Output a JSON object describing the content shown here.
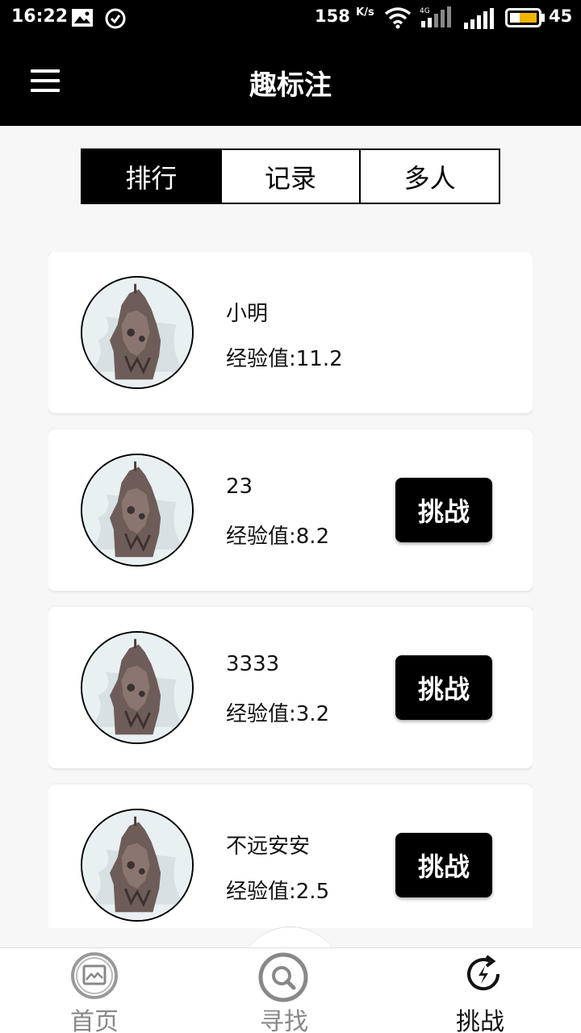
{
  "status_bar": {
    "time": "16:22",
    "network_speed": "158",
    "speed_unit": "K/s",
    "signal_type": "4G",
    "battery": "45",
    "icons": [
      "image-icon",
      "check-circle-icon",
      "wifi-icon",
      "cell-signal-icon",
      "battery-icon"
    ]
  },
  "app_bar": {
    "title": "趣标注",
    "menu_icon": "hamburger-menu-icon"
  },
  "tabs": [
    {
      "label": "排行",
      "active": true
    },
    {
      "label": "记录",
      "active": false
    },
    {
      "label": "多人",
      "active": false
    }
  ],
  "leaderboard": [
    {
      "name": "小明",
      "exp": "经验值:11.2",
      "has_challenge": false
    },
    {
      "name": "23",
      "exp": "经验值:8.2",
      "has_challenge": true,
      "challenge_label": "挑战"
    },
    {
      "name": "3333",
      "exp": "经验值:3.2",
      "has_challenge": true,
      "challenge_label": "挑战"
    },
    {
      "name": "不远安安",
      "exp": "经验值:2.5",
      "has_challenge": true,
      "challenge_label": "挑战"
    }
  ],
  "bottom_nav": [
    {
      "label": "首页",
      "icon": "image-icon",
      "active": false
    },
    {
      "label": "寻找",
      "icon": "search-icon",
      "active": false
    },
    {
      "label": "挑战",
      "icon": "lightning-refresh-icon",
      "active": true
    }
  ],
  "colors": {
    "bar_background": "#000000",
    "page_background": "#f7f7f7",
    "inactive_nav": "#888888"
  }
}
